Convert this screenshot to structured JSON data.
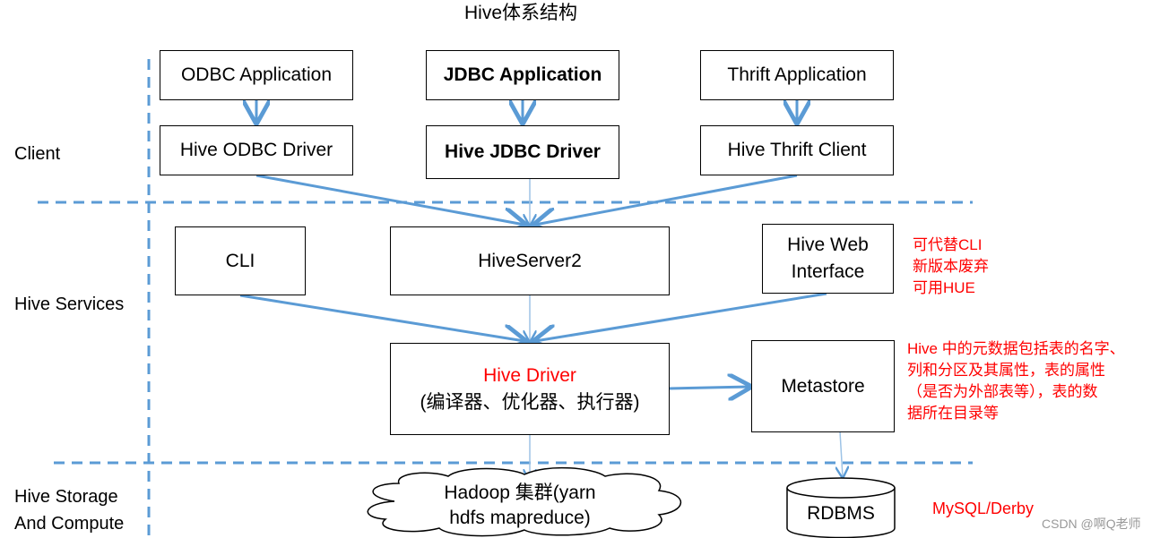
{
  "title": "Hive体系结构",
  "layers": {
    "client": "Client",
    "services": "Hive Services",
    "storage_line1": "Hive Storage",
    "storage_line2": "And Compute"
  },
  "client": {
    "odbc_app": "ODBC Application",
    "jdbc_app": "JDBC Application",
    "thrift_app": "Thrift Application",
    "odbc_driver": "Hive ODBC Driver",
    "jdbc_driver": "Hive JDBC Driver",
    "thrift_client": "Hive Thrift Client"
  },
  "services": {
    "cli": "CLI",
    "hiveserver2": "HiveServer2",
    "web_line1": "Hive Web",
    "web_line2": "Interface",
    "driver_title": "Hive Driver",
    "driver_sub": "(编译器、优化器、执行器)",
    "metastore": "Metastore"
  },
  "storage": {
    "hadoop_line1": "Hadoop 集群(yarn",
    "hadoop_line2": "hdfs mapreduce)",
    "rdbms": "RDBMS",
    "rdbms_note": "MySQL/Derby"
  },
  "notes": {
    "web_note": [
      "可代替CLI",
      "新版本废弃",
      "可用HUE"
    ],
    "metastore_note": [
      "Hive 中的元数据包括表的名字、",
      "列和分区及其属性，表的属性",
      "（是否为外部表等），表的数",
      "据所在目录等"
    ]
  },
  "watermark": "CSDN @啊Q老师",
  "colors": {
    "arrow": "#5b9bd5",
    "note": "#ff0000"
  }
}
